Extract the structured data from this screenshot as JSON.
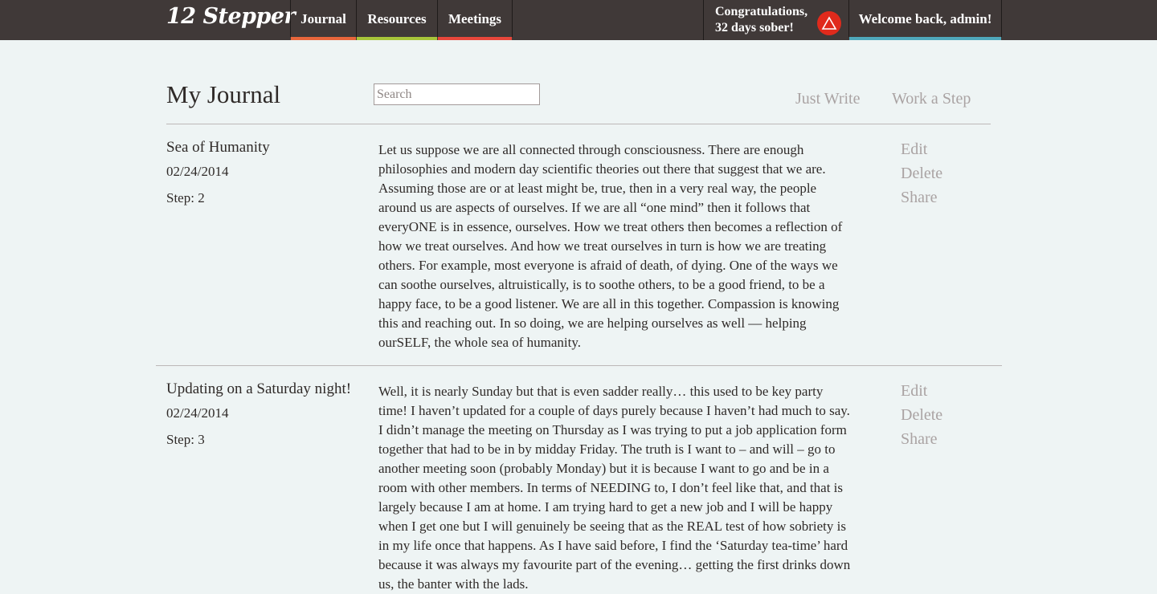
{
  "app": {
    "logo": "12 Stepper"
  },
  "nav": {
    "tabs": [
      {
        "label": "Journal",
        "accent": "#e8663b"
      },
      {
        "label": "Resources",
        "accent": "#a8c53a"
      },
      {
        "label": "Meetings",
        "accent": "#e8473b"
      }
    ],
    "sober_line1": "Congratulations,",
    "sober_line2": "32 days sober!",
    "sober_icon": "aa-triangle-icon",
    "sober_icon_color": "#e02a1c",
    "welcome": "Welcome back, admin!",
    "welcome_accent": "#4fa8bb"
  },
  "header": {
    "title": "My Journal",
    "search_placeholder": "Search",
    "links": [
      "Just Write",
      "Work a Step"
    ]
  },
  "entries": [
    {
      "title": "Sea of Humanity",
      "date": "02/24/2014",
      "step": "Step: 2",
      "body": "Let us suppose we are all connected through consciousness. There are enough philosophies and modern day scientific theories out there that suggest that we are. Assuming those are or at least might be, true, then in a very real way, the people around us are aspects of ourselves. If we are all “one mind” then it follows that everyONE is in essence, ourselves. How we treat others then becomes a reflection of how we treat ourselves. And how we treat ourselves in turn is how we are treating others. For example, most everyone is afraid of death, of dying. One of the ways we can soothe ourselves, altruistically, is to soothe others, to be a good friend, to be a happy face, to be a good listener. We are all in this together. Compassion is knowing this and reaching out. In so doing, we are helping ourselves as well — helping ourSELF, the whole sea of humanity.",
      "actions": [
        "Edit",
        "Delete",
        "Share"
      ]
    },
    {
      "title": "Updating on a Saturday night!",
      "date": "02/24/2014",
      "step": "Step: 3",
      "body": "Well, it is nearly Sunday but that is even sadder really… this used to be key party time! I haven’t updated for a couple of days purely because I haven’t had much to say. I didn’t manage the meeting on Thursday as I was trying to put a job application form together that had to be in by midday Friday. The truth is I want to – and will – go to another meeting soon (probably Monday) but it is because I want to go and be in a room with other members. In terms of NEEDING to, I don’t feel like that, and that is largely because I am at home. I am trying hard to get a new job and I will be happy when I get one but I will genuinely be seeing that as the REAL test of how sobriety is in my life once that happens. As I have said before, I find the ‘Saturday tea-time’ hard because it was always my favourite part of the evening… getting the first drinks down us, the banter with the lads.",
      "actions": [
        "Edit",
        "Delete",
        "Share"
      ]
    }
  ]
}
